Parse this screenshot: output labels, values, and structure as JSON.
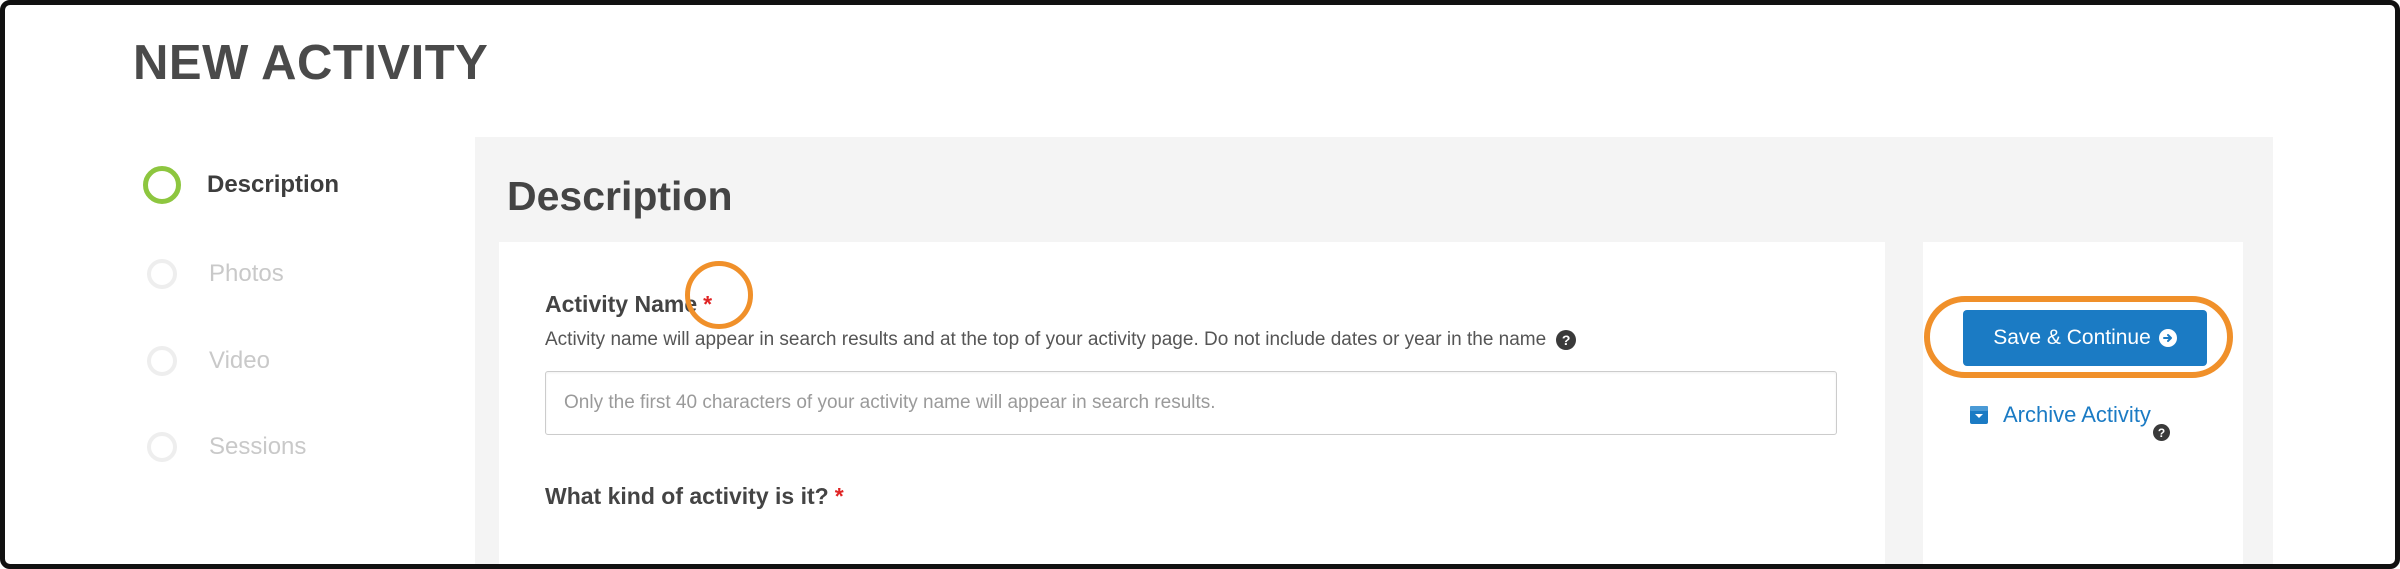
{
  "page": {
    "title": "NEW ACTIVITY"
  },
  "sidebar": {
    "steps": [
      {
        "label": "Description",
        "active": true
      },
      {
        "label": "Photos",
        "active": false
      },
      {
        "label": "Video",
        "active": false
      },
      {
        "label": "Sessions",
        "active": false
      }
    ]
  },
  "main": {
    "section_title": "Description",
    "activity_name": {
      "label": "Activity Name",
      "required_mark": "*",
      "help_text": "Activity name will appear in search results and at the top of your activity page. Do not include dates or year in the name",
      "help_icon": "question-circle-icon",
      "value": "",
      "placeholder": "Only the first 40 characters of your activity name will appear in search results."
    },
    "activity_kind": {
      "label": "What kind of activity is it?",
      "required_mark": "*"
    }
  },
  "actions": {
    "save_label": "Save & Continue",
    "save_icon": "arrow-circle-right-icon",
    "archive_label": "Archive Activity",
    "archive_icon": "archive-box-icon",
    "archive_help_icon": "question-circle-icon"
  },
  "colors": {
    "accent_blue": "#1b7bc4",
    "active_step_green": "#8dc63f",
    "required_red": "#e02424",
    "annotation_orange": "#f0902a",
    "panel_gray": "#f4f4f4"
  }
}
